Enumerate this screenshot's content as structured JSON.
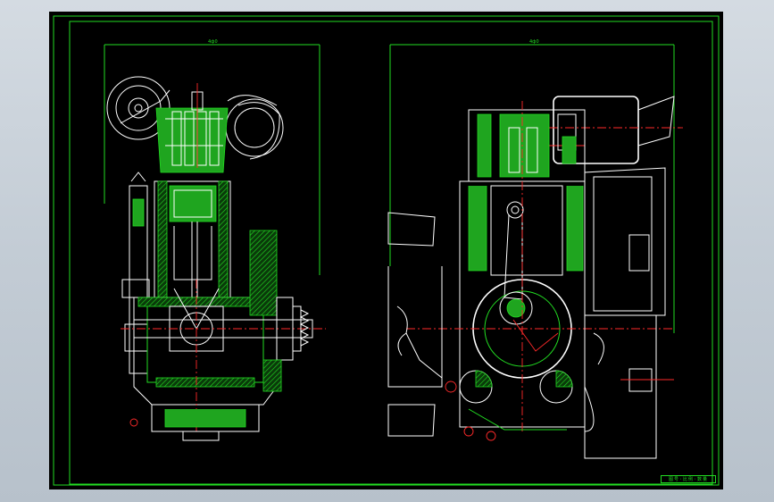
{
  "drawing": {
    "background": "#000000",
    "colors": {
      "outline": "#ffffff",
      "section": "#22dd22",
      "centerline": "#ff2a2a"
    },
    "views": [
      {
        "name": "side-section-view",
        "dimension_label": "4ф0"
      },
      {
        "name": "front-section-view",
        "dimension_label": "4ф0"
      }
    ],
    "title_block": {
      "text": "图号·比例·数量"
    }
  }
}
